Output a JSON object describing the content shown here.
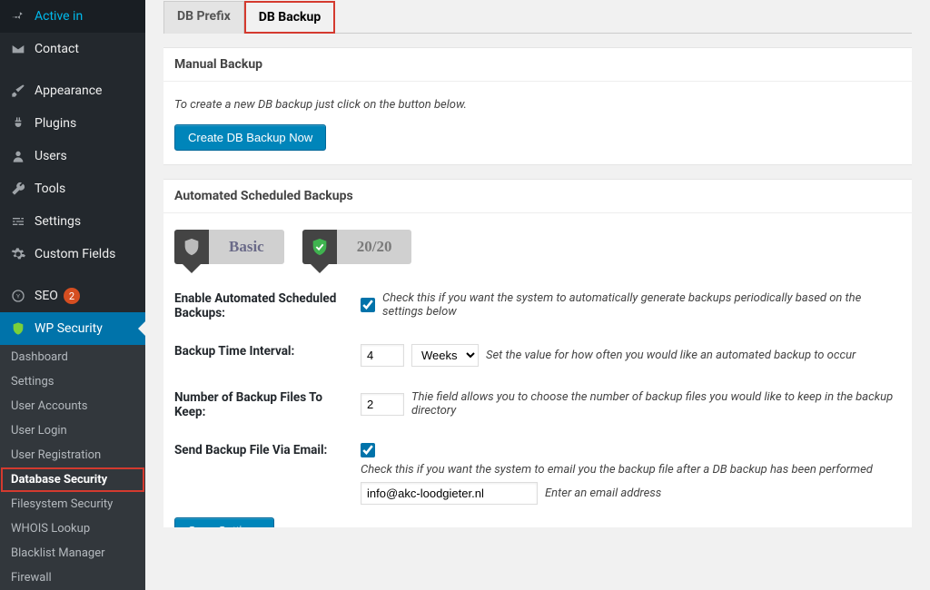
{
  "sidebar": {
    "items": [
      {
        "label": "Active in",
        "icon": "pin"
      },
      {
        "label": "Contact",
        "icon": "mail"
      },
      {
        "label": "Appearance",
        "icon": "brush"
      },
      {
        "label": "Plugins",
        "icon": "plug"
      },
      {
        "label": "Users",
        "icon": "users"
      },
      {
        "label": "Tools",
        "icon": "wrench"
      },
      {
        "label": "Settings",
        "icon": "sliders"
      },
      {
        "label": "Custom Fields",
        "icon": "gear"
      },
      {
        "label": "SEO",
        "icon": "seo",
        "badge": "2"
      },
      {
        "label": "WP Security",
        "icon": "shield",
        "current": true
      }
    ],
    "subitems": [
      {
        "label": "Dashboard"
      },
      {
        "label": "Settings"
      },
      {
        "label": "User Accounts"
      },
      {
        "label": "User Login"
      },
      {
        "label": "User Registration"
      },
      {
        "label": "Database Security",
        "active": true
      },
      {
        "label": "Filesystem Security"
      },
      {
        "label": "WHOIS Lookup"
      },
      {
        "label": "Blacklist Manager"
      },
      {
        "label": "Firewall"
      }
    ]
  },
  "tabs": [
    {
      "label": "DB Prefix",
      "active": false
    },
    {
      "label": "DB Backup",
      "active": true,
      "highlight": true
    }
  ],
  "panels": {
    "manual": {
      "title": "Manual Backup",
      "note": "To create a new DB backup just click on the button below.",
      "button": "Create DB Backup Now"
    },
    "auto": {
      "title": "Automated Scheduled Backups",
      "badges": {
        "basic": "Basic",
        "score": "20/20"
      },
      "rows": {
        "enable": {
          "label": "Enable Automated Scheduled Backups:",
          "checked": true,
          "help": "Check this if you want the system to automatically generate backups periodically based on the settings below"
        },
        "interval": {
          "label": "Backup Time Interval:",
          "value": "4",
          "unit": "Weeks",
          "help": "Set the value for how often you would like an automated backup to occur"
        },
        "keep": {
          "label": "Number of Backup Files To Keep:",
          "value": "2",
          "help": "Thie field allows you to choose the number of backup files you would like to keep in the backup directory"
        },
        "email": {
          "label": "Send Backup File Via Email:",
          "checked": true,
          "help": "Check this if you want the system to email you the backup file after a DB backup has been performed",
          "value": "info@akc-loodgieter.nl",
          "placeholder_help": "Enter an email address"
        }
      },
      "save_button": "Save Settings"
    }
  }
}
